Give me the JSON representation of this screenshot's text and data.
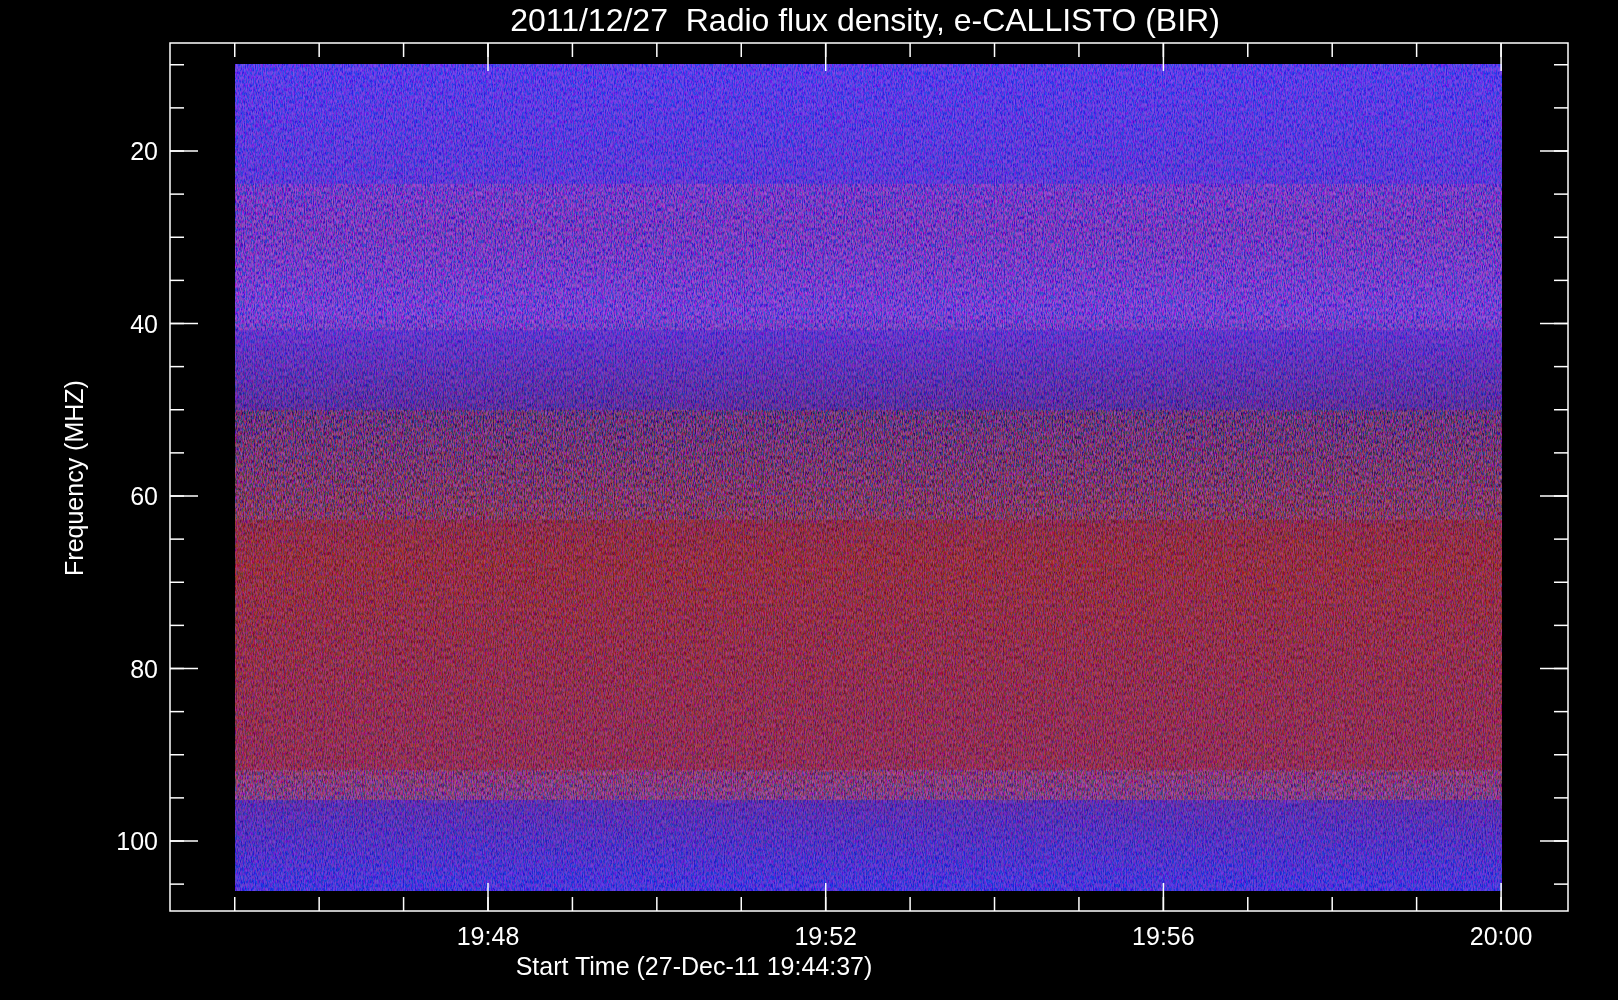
{
  "title": "2011/12/27  Radio flux density, e-CALLISTO (BIR)",
  "ylabel": "Frequency (MHZ)",
  "xlabel": "Start Time (27-Dec-11 19:44:37)",
  "yticks": [
    "20",
    "40",
    "60",
    "80",
    "100"
  ],
  "xticks": [
    "19:48",
    "19:52",
    "19:56",
    "20:00"
  ],
  "spectrogram": {
    "kind": "picture"
  }
}
